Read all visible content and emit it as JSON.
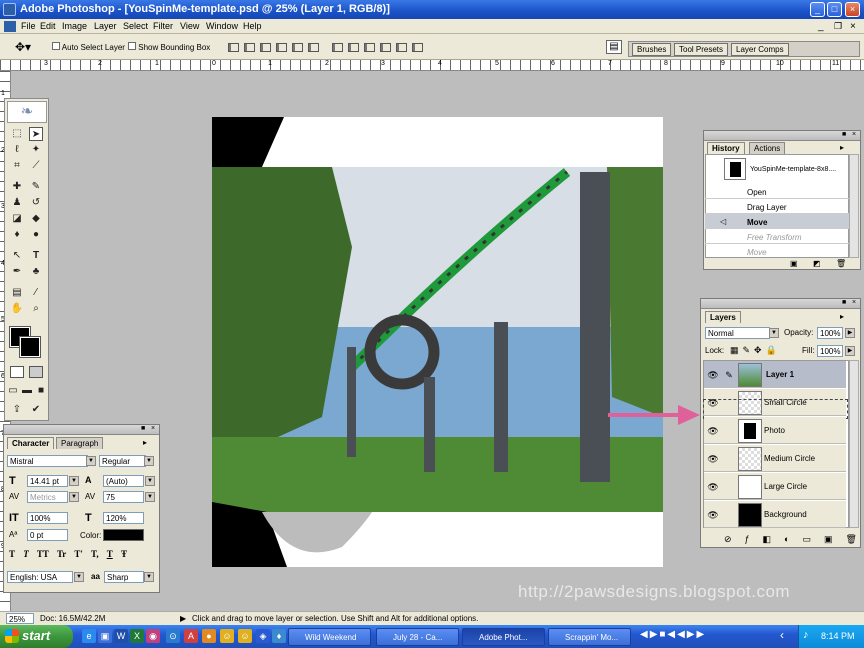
{
  "window": {
    "title": "Adobe Photoshop - [YouSpinMe-template.psd @ 25% (Layer 1, RGB/8)]",
    "min": "_",
    "max": "□",
    "close": "×"
  },
  "menu": [
    "File",
    "Edit",
    "Image",
    "Layer",
    "Select",
    "Filter",
    "View",
    "Window",
    "Help"
  ],
  "options": {
    "auto_select": "Auto Select Layer",
    "bounding_box": "Show Bounding Box"
  },
  "palette_well": [
    "Brushes",
    "Tool Presets",
    "Layer Comps"
  ],
  "ruler_h": [
    "3",
    "2",
    "1",
    "0",
    "1",
    "2",
    "3",
    "4",
    "5",
    "6",
    "7",
    "8",
    "9",
    "10",
    "11"
  ],
  "ruler_v": [
    "1",
    "2",
    "3",
    "4",
    "5",
    "6",
    "7",
    "8",
    "9"
  ],
  "history": {
    "tabs": [
      "History",
      "Actions"
    ],
    "snapshot": "YouSpinMe-template-8x8....",
    "items": [
      "Open",
      "Drag Layer",
      "Move",
      "Free Transform",
      "Move"
    ]
  },
  "layers": {
    "tab": "Layers",
    "blend_mode": "Normal",
    "opacity_label": "Opacity:",
    "opacity": "100%",
    "lock_label": "Lock:",
    "fill_label": "Fill:",
    "fill": "100%",
    "rows": [
      "Layer 1",
      "Small Circle",
      "Photo",
      "Medium Circle",
      "Large Circle",
      "Background"
    ]
  },
  "character": {
    "tabs": [
      "Character",
      "Paragraph"
    ],
    "font": "Mistral",
    "style": "Regular",
    "size": "14.41 pt",
    "leading": "(Auto)",
    "kerning": "Metrics",
    "tracking": "75",
    "vscale": "100%",
    "hscale": "120%",
    "baseline": "0 pt",
    "color_label": "Color:",
    "faux": [
      "T",
      "T",
      "TT",
      "Tr",
      "T'",
      "T,",
      "T",
      "Ŧ"
    ],
    "language": "English: USA",
    "aa_label": "aa",
    "antialias": "Sharp"
  },
  "status": {
    "zoom": "25%",
    "doc": "Doc: 16.5M/42.2M",
    "hint": "Click and drag to move layer or selection.  Use Shift and Alt for additional options."
  },
  "watermark": "http://2pawsdesigns.blogspot.com",
  "taskbar": {
    "start": "start",
    "tasks": [
      "Wild Weekend",
      "July 28 - Ca...",
      "Adobe Phot...",
      "Scrappin' Mo..."
    ],
    "time": "8:14 PM"
  }
}
